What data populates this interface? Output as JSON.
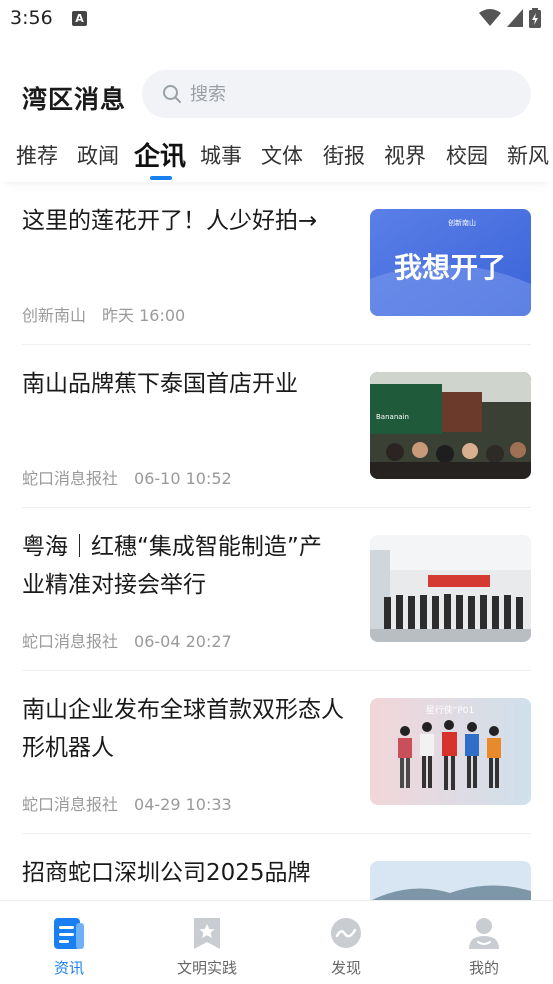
{
  "status_bar": {
    "time": "3:56",
    "notification_glyph": "A"
  },
  "header": {
    "title": "湾区消息",
    "search_placeholder": "搜索"
  },
  "tabs": [
    {
      "label": "推荐",
      "active": false
    },
    {
      "label": "政闻",
      "active": false
    },
    {
      "label": "企讯",
      "active": true
    },
    {
      "label": "城事",
      "active": false
    },
    {
      "label": "文体",
      "active": false
    },
    {
      "label": "街报",
      "active": false
    },
    {
      "label": "视界",
      "active": false
    },
    {
      "label": "校园",
      "active": false
    },
    {
      "label": "新风",
      "active": false
    }
  ],
  "articles": [
    {
      "title": "这里的莲花开了！人少好拍→",
      "source": "创新南山",
      "time": "昨天 16:00",
      "thumb_text": "我想开了",
      "thumb_logo": "创新南山"
    },
    {
      "title": "南山品牌蕉下泰国首店开业",
      "source": "蛇口消息报社",
      "time": "06-10 10:52",
      "thumb_text": "Bananain"
    },
    {
      "title": "粤海｜红穗“集成智能制造”产业精准对接会举行",
      "source": "蛇口消息报社",
      "time": "06-04 20:27"
    },
    {
      "title": "南山企业发布全球首款双形态人形机器人",
      "source": "蛇口消息报社",
      "time": "04-29 10:33",
      "thumb_text": "星行侠“P01"
    },
    {
      "title": "招商蛇口深圳公司2025品牌",
      "source": "",
      "time": ""
    }
  ],
  "bottom_nav": [
    {
      "label": "资讯",
      "icon": "document-icon",
      "active": true
    },
    {
      "label": "文明实践",
      "icon": "bookmark-star-icon",
      "active": false
    },
    {
      "label": "发现",
      "icon": "discover-wave-icon",
      "active": false
    },
    {
      "label": "我的",
      "icon": "profile-icon",
      "active": false
    }
  ],
  "colors": {
    "accent": "#1a7ff0",
    "text": "#1a1a1a",
    "meta": "#9a9a9a"
  }
}
